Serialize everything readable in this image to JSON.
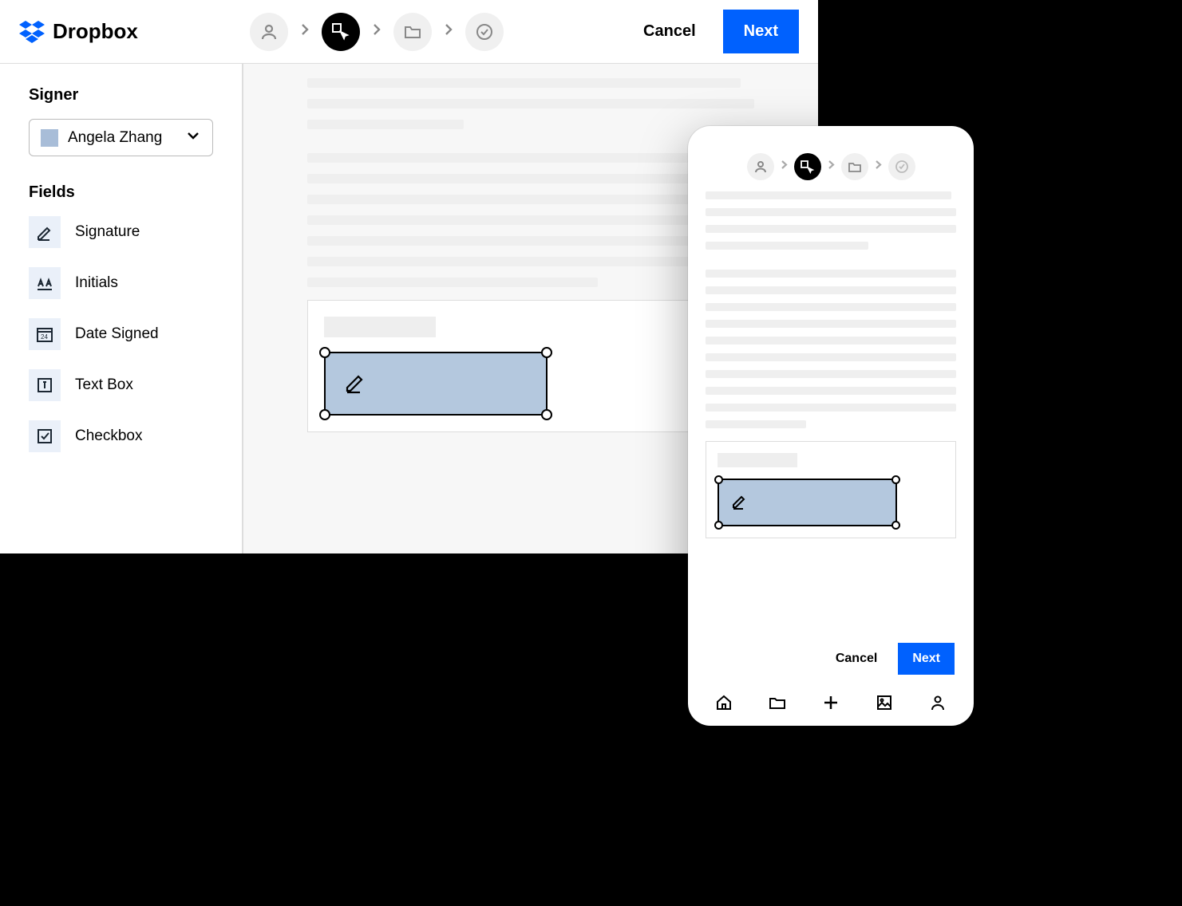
{
  "brand": {
    "name": "Dropbox"
  },
  "header": {
    "cancel_label": "Cancel",
    "next_label": "Next"
  },
  "sidebar": {
    "signer_heading": "Signer",
    "signer_name": "Angela Zhang",
    "fields_heading": "Fields",
    "fields": [
      {
        "label": "Signature"
      },
      {
        "label": "Initials"
      },
      {
        "label": "Date Signed"
      },
      {
        "label": "Text Box"
      },
      {
        "label": "Checkbox"
      }
    ]
  },
  "mobile": {
    "cancel_label": "Cancel",
    "next_label": "Next"
  },
  "colors": {
    "primary": "#0061fe",
    "signer_swatch": "#a8bdd8",
    "dropzone_fill": "#b4c8de",
    "field_icon_bg": "#eaf0f9"
  }
}
